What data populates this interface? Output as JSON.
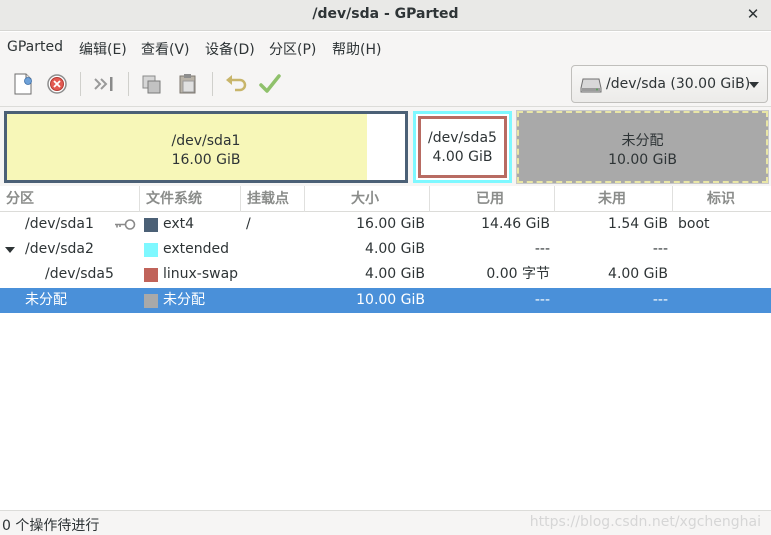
{
  "window": {
    "title": "/dev/sda - GParted",
    "close_glyph": "✕"
  },
  "menubar": {
    "items": [
      "GParted",
      "编辑(E)",
      "查看(V)",
      "设备(D)",
      "分区(P)",
      "帮助(H)"
    ]
  },
  "toolbar": {
    "icons": [
      "new-partition-icon",
      "delete-partition-icon",
      "resize-move-icon",
      "copy-icon",
      "paste-icon",
      "undo-icon",
      "apply-icon"
    ],
    "device_selector": "/dev/sda   (30.00 GiB)"
  },
  "disk_map": {
    "sda1": {
      "name": "/dev/sda1",
      "size": "16.00 GiB",
      "used_fraction": 0.904,
      "fill_color": "#f7f7b8",
      "border_color": "#4b6076"
    },
    "sda5": {
      "name": "/dev/sda5",
      "size": "4.00 GiB",
      "border_color": "#b86b62"
    },
    "extended_border_color": "#7ef8ff",
    "unallocated": {
      "name": "未分配",
      "size": "10.00 GiB",
      "color": "#a9a9a9"
    }
  },
  "table": {
    "columns": [
      "分区",
      "文件系统",
      "挂载点",
      "大小",
      "已用",
      "未用",
      "标识"
    ],
    "rows": [
      {
        "partition": "/dev/sda1",
        "filesystem": "ext4",
        "fs_color": "#4b6076",
        "mount": "/",
        "size": "16.00 GiB",
        "used": "14.46 GiB",
        "unused": "1.54 GiB",
        "flags": "boot"
      },
      {
        "partition": "/dev/sda2",
        "filesystem": "extended",
        "fs_color": "#7ef8ff",
        "mount": "",
        "size": "4.00 GiB",
        "used": "---",
        "unused": "---",
        "flags": ""
      },
      {
        "partition": "/dev/sda5",
        "filesystem": "linux-swap",
        "fs_color": "#c0635a",
        "mount": "",
        "size": "4.00 GiB",
        "used": "0.00 字节",
        "unused": "4.00 GiB",
        "flags": ""
      },
      {
        "partition": "未分配",
        "filesystem": "未分配",
        "fs_color": "#a9a9a9",
        "mount": "",
        "size": "10.00 GiB",
        "used": "---",
        "unused": "---",
        "flags": ""
      }
    ]
  },
  "status": {
    "text": "0 个操作待进行",
    "watermark": "https://blog.csdn.net/xgchenghai"
  },
  "colors": {
    "selection": "#4a90d9"
  }
}
